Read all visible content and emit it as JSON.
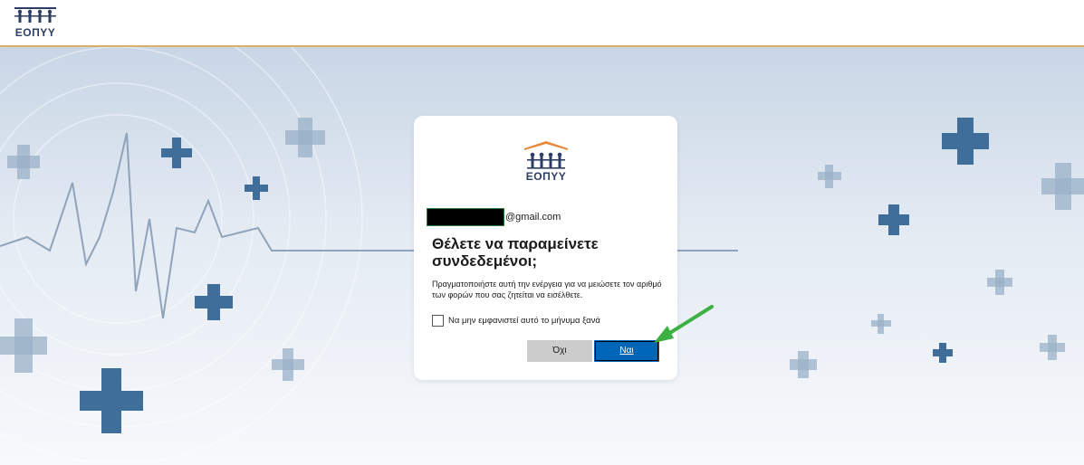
{
  "header": {
    "logo_icon": "eopyy-logo-icon",
    "logo_text": "ΕΟΠΥΥ"
  },
  "dialog": {
    "logo_icon": "eopyy-logo-icon",
    "logo_text": "ΕΟΠΥΥ",
    "email_suffix": "@gmail.com",
    "title": "Θέλετε να παραμείνετε συνδεδεμένοι;",
    "description": "Πραγματοποιήστε αυτή την ενέργεια για να μειώσετε τον αριθμό των φορών που σας ζητείται να εισέλθετε.",
    "checkbox_label": "Να μην εμφανιστεί αυτό το μήνυμα ξανά",
    "checkbox_checked": false,
    "no_label": "Όχι",
    "yes_label": "Ναι"
  },
  "annotation": {
    "arrow_icon": "green-arrow-icon",
    "arrow_color": "#3cb043"
  },
  "colors": {
    "brand_blue": "#0067b8",
    "accent_gold": "#d9b26a",
    "logo_roof": "#e8893a",
    "logo_figures": "#2c3e66"
  }
}
